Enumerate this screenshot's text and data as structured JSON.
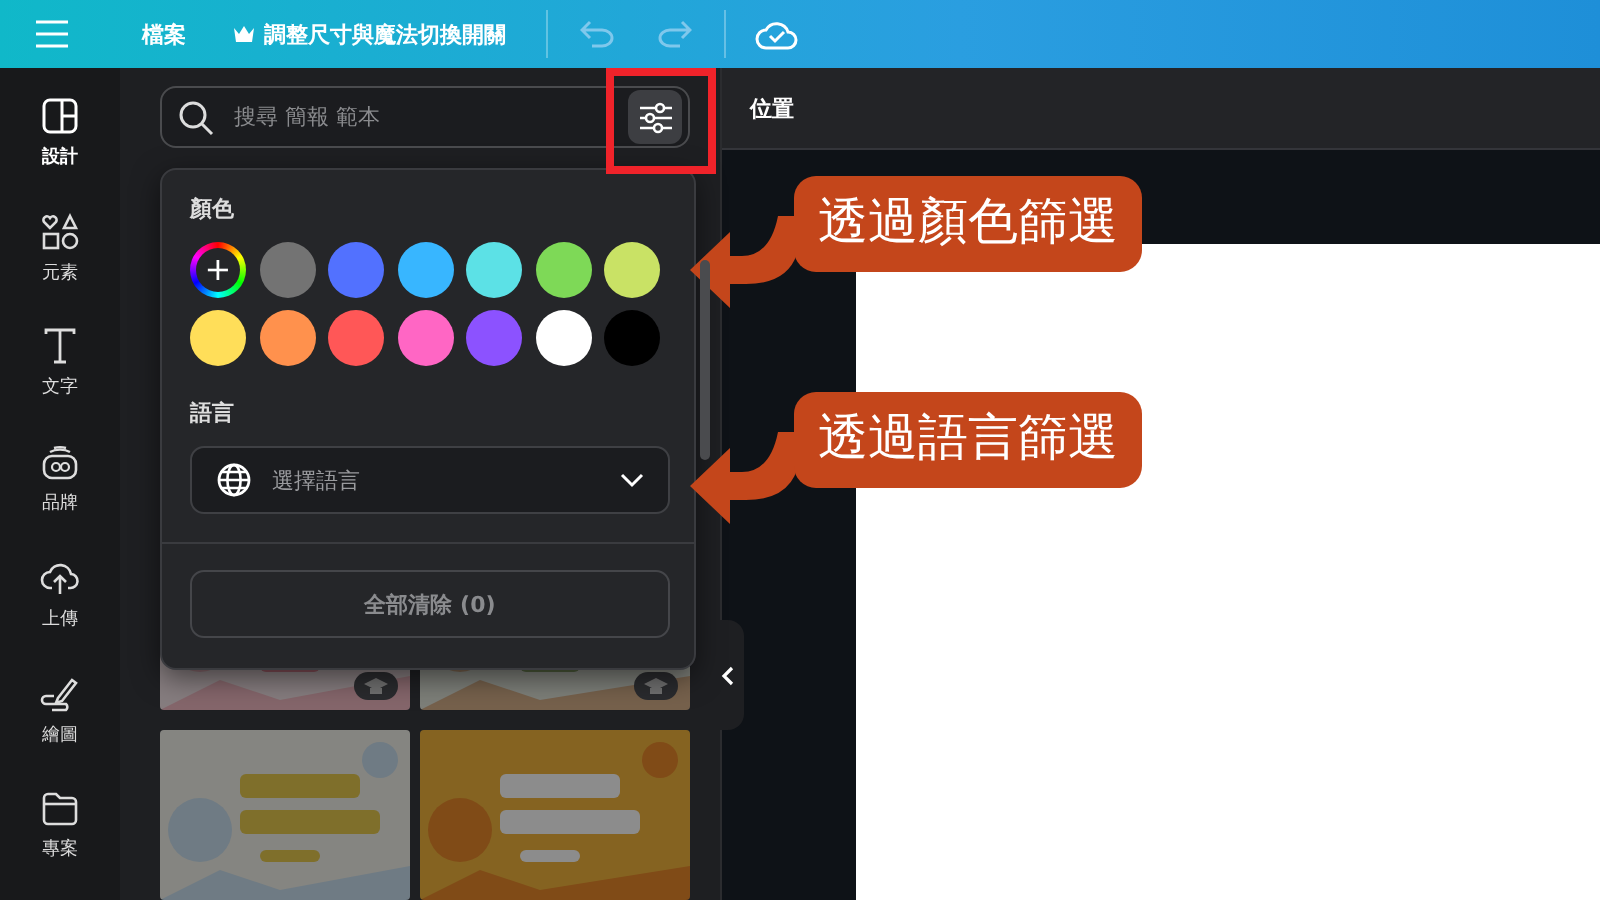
{
  "top_bar": {
    "file_menu": "檔案",
    "resize_button": "調整尺寸與魔法切換開關"
  },
  "rail": {
    "items": [
      {
        "label": "設計",
        "kind": "layout",
        "selected": true
      },
      {
        "label": "元素",
        "kind": "shapes",
        "selected": false
      },
      {
        "label": "文字",
        "kind": "text",
        "selected": false
      },
      {
        "label": "品牌",
        "kind": "brand",
        "selected": false
      },
      {
        "label": "上傳",
        "kind": "upload",
        "selected": false
      },
      {
        "label": "繪圖",
        "kind": "draw",
        "selected": false
      },
      {
        "label": "專案",
        "kind": "folder",
        "selected": false
      }
    ]
  },
  "search": {
    "placeholder": "搜尋 簡報 範本"
  },
  "filter": {
    "colors_title": "顏色",
    "colors": [
      {
        "kind": "add",
        "label": "+"
      },
      {
        "kind": "swatch",
        "color": "#737373"
      },
      {
        "kind": "swatch",
        "color": "#5271ff"
      },
      {
        "kind": "swatch",
        "color": "#38b6ff"
      },
      {
        "kind": "swatch",
        "color": "#5ce1e6"
      },
      {
        "kind": "swatch",
        "color": "#7ed957"
      },
      {
        "kind": "swatch",
        "color": "#c9e265"
      },
      {
        "kind": "swatch",
        "color": "#ffde59"
      },
      {
        "kind": "swatch",
        "color": "#ff914d"
      },
      {
        "kind": "swatch",
        "color": "#ff5757"
      },
      {
        "kind": "swatch",
        "color": "#ff66c4"
      },
      {
        "kind": "swatch",
        "color": "#8c52ff"
      },
      {
        "kind": "swatch",
        "color": "#ffffff"
      },
      {
        "kind": "swatch",
        "color": "#000000"
      }
    ],
    "language_title": "語言",
    "language": {
      "placeholder": "選擇語言"
    },
    "clear_button": "全部清除 (0)"
  },
  "header": {
    "title": "位置"
  },
  "templates": [
    {
      "kind": "picture",
      "badge": true
    },
    {
      "kind": "picture",
      "badge": true
    },
    {
      "kind": "picture",
      "badge": false
    },
    {
      "kind": "picture",
      "badge": false
    }
  ],
  "annotations": [
    {
      "text": "透過顏色篩選"
    },
    {
      "text": "透過語言篩選"
    }
  ]
}
